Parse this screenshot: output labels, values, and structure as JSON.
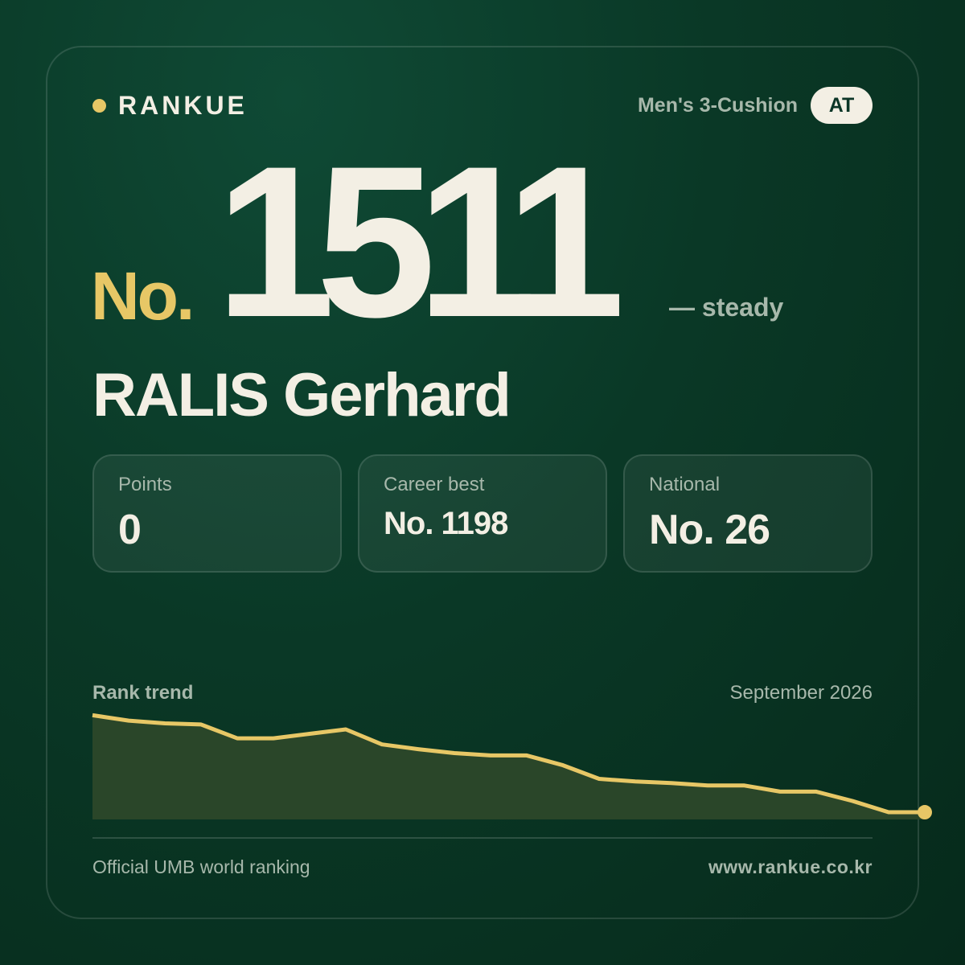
{
  "brand": {
    "name": "RANKUE"
  },
  "header": {
    "category": "Men's 3-Cushion",
    "country_code": "AT"
  },
  "rank": {
    "prefix": "No.",
    "number": "1511",
    "change": "— steady"
  },
  "player": {
    "name": "RALIS Gerhard"
  },
  "stats": [
    {
      "label": "Points",
      "value": "0"
    },
    {
      "label": "Career best",
      "value": "No. 1198"
    },
    {
      "label": "National",
      "value": "No. 26"
    }
  ],
  "trend": {
    "label": "Rank trend",
    "date": "September 2026"
  },
  "chart_data": {
    "type": "area",
    "values": [
      96.7,
      91.7,
      89.2,
      88.1,
      75.3,
      75.3,
      79.5,
      83.6,
      69.6,
      65.2,
      61.6,
      59.4,
      59.4,
      50.3,
      37.7,
      35.2,
      33.8,
      31.6,
      31.6,
      25.8,
      25.8,
      17.2,
      6.7,
      6.7
    ],
    "ylim": [
      0,
      100
    ],
    "line_color": "#e7c766",
    "fill_color": "#2a4629"
  },
  "footer": {
    "source": "Official UMB world ranking",
    "website": "www.rankue.co.kr"
  },
  "colors": {
    "accent": "#e7c766",
    "text": "#f3efe4",
    "muted": "#a7b8ab"
  }
}
